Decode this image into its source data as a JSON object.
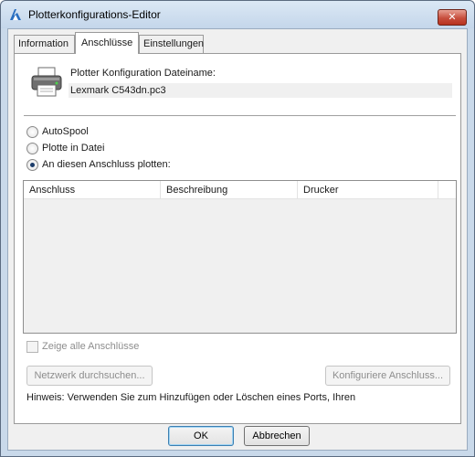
{
  "window": {
    "title": "Plotterkonfigurations-Editor",
    "close_label": "✕",
    "accent_color": "#c74f3d"
  },
  "tabs": [
    {
      "label": "Information",
      "active": false
    },
    {
      "label": "Anschlüsse",
      "active": true
    },
    {
      "label": "Einstellungen",
      "active": false
    }
  ],
  "config": {
    "label": "Plotter Konfiguration Dateiname:",
    "filename": "Lexmark C543dn.pc3",
    "icon": "printer-icon"
  },
  "output_options": [
    {
      "label": "AutoSpool",
      "checked": false
    },
    {
      "label": "Plotte in Datei",
      "checked": false
    },
    {
      "label": "An diesen Anschluss plotten:",
      "checked": true
    }
  ],
  "ports_table": {
    "columns": [
      "Anschluss",
      "Beschreibung",
      "Drucker"
    ],
    "rows": []
  },
  "show_all_ports": {
    "label": "Zeige alle Anschlüsse",
    "checked": false,
    "enabled": false
  },
  "buttons": {
    "browse_network": "Netzwerk durchsuchen...",
    "configure_port": "Konfiguriere Anschluss...",
    "ok": "OK",
    "cancel": "Abbrechen"
  },
  "hint": "Hinweis: Verwenden Sie zum Hinzufügen oder Löschen eines Ports, Ihren"
}
